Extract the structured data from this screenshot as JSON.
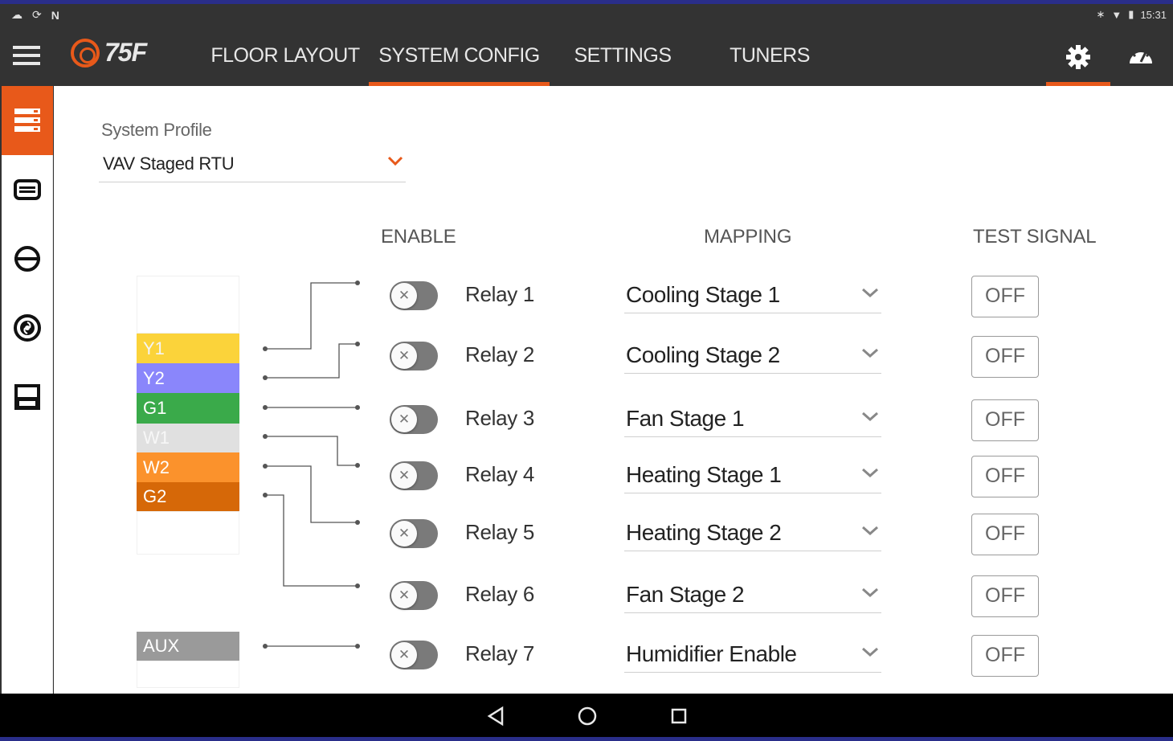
{
  "status_bar": {
    "left_icons": [
      "cloud-outline-icon",
      "sync-icon",
      "notification-n-icon"
    ],
    "time": "15:31"
  },
  "app_bar": {
    "logo_text": "75F",
    "tabs": [
      {
        "label": "FLOOR LAYOUT",
        "active": false
      },
      {
        "label": "SYSTEM CONFIG",
        "active": true
      },
      {
        "label": "SETTINGS",
        "active": false
      },
      {
        "label": "TUNERS",
        "active": false
      }
    ]
  },
  "colors": {
    "accent": "#e8591a",
    "bar": "#333333",
    "y1": "#fbd33a",
    "y2": "#8a86fb",
    "g1": "#3aaa4a",
    "w1": "#e0e0e0",
    "w2": "#fb922c",
    "g2": "#d66808",
    "aux": "#9a9a9a"
  },
  "sidebar": {
    "items": [
      {
        "icon": "system-list-icon",
        "active": true
      },
      {
        "icon": "device-icon",
        "active": false
      },
      {
        "icon": "oao-icon",
        "active": false
      },
      {
        "icon": "fan-icon",
        "active": false
      },
      {
        "icon": "rtu-icon",
        "active": false
      }
    ]
  },
  "profile": {
    "label": "System Profile",
    "value": "VAV Staged RTU"
  },
  "columns": {
    "enable": "ENABLE",
    "mapping": "MAPPING",
    "test_signal": "TEST SIGNAL"
  },
  "terminals": {
    "y1": "Y1",
    "y2": "Y2",
    "g1": "G1",
    "w1": "W1",
    "w2": "W2",
    "g2": "G2",
    "aux": "AUX"
  },
  "relays": [
    {
      "label": "Relay 1",
      "mapping": "Cooling Stage 1",
      "enabled": false,
      "test": "OFF"
    },
    {
      "label": "Relay 2",
      "mapping": "Cooling Stage 2",
      "enabled": false,
      "test": "OFF"
    },
    {
      "label": "Relay 3",
      "mapping": "Fan Stage 1",
      "enabled": false,
      "test": "OFF"
    },
    {
      "label": "Relay 4",
      "mapping": "Heating Stage 1",
      "enabled": false,
      "test": "OFF"
    },
    {
      "label": "Relay 5",
      "mapping": "Heating Stage 2",
      "enabled": false,
      "test": "OFF"
    },
    {
      "label": "Relay 6",
      "mapping": "Fan Stage 2",
      "enabled": false,
      "test": "OFF"
    },
    {
      "label": "Relay 7",
      "mapping": "Humidifier Enable",
      "enabled": false,
      "test": "OFF"
    }
  ]
}
